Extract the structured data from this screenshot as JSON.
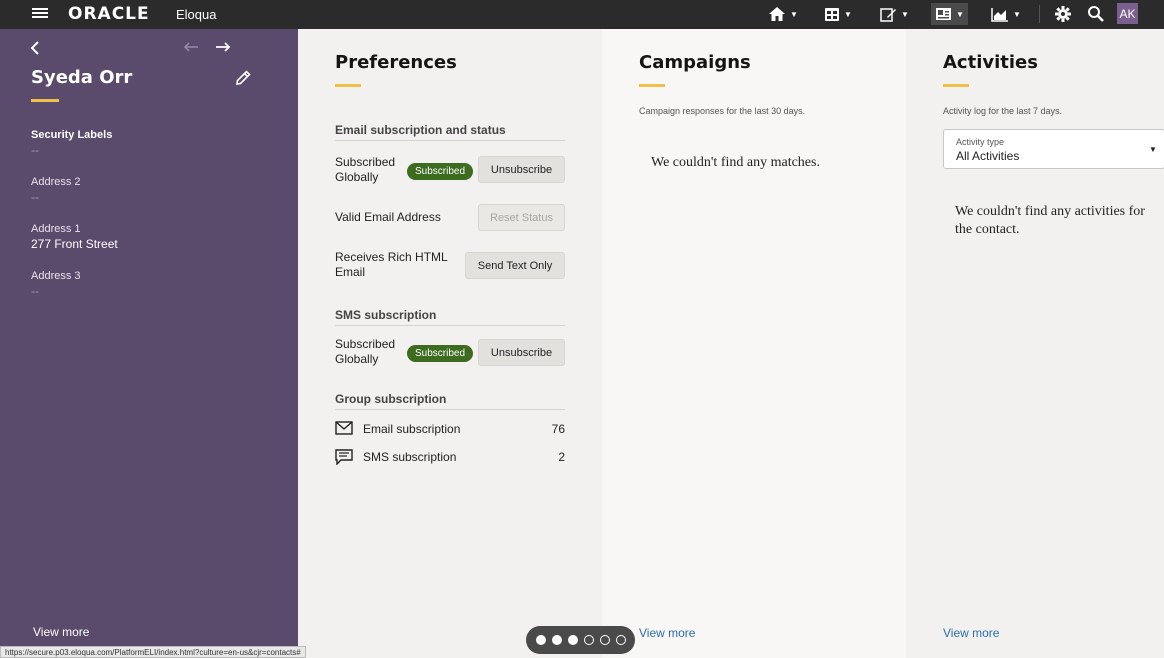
{
  "header": {
    "brand": "ORACLE",
    "product": "Eloqua",
    "icons": [
      {
        "name": "home-icon",
        "glyph": "⌂"
      },
      {
        "name": "contacts-icon",
        "glyph": "▣"
      },
      {
        "name": "edit-icon",
        "glyph": "✎"
      },
      {
        "name": "contact-card-icon",
        "glyph": "▤"
      },
      {
        "name": "chart-icon",
        "glyph": "▟"
      }
    ],
    "avatar": "AK"
  },
  "sidebar": {
    "name": "Syeda Orr",
    "fields": [
      {
        "label": "Security Labels",
        "value": "--"
      },
      {
        "label": "Address 2",
        "value": "--"
      },
      {
        "label": "Address 1",
        "value": "277 Front Street"
      },
      {
        "label": "Address 3",
        "value": "--"
      }
    ],
    "view_more": "View more"
  },
  "preferences": {
    "title": "Preferences",
    "email_section": "Email subscription and status",
    "rows": [
      {
        "label": "Subscribed Globally",
        "badge": "Subscribed",
        "button": "Unsubscribe"
      },
      {
        "label": "Valid Email Address",
        "button": "Reset Status"
      },
      {
        "label": "Receives Rich HTML Email",
        "button": "Send Text Only"
      }
    ],
    "sms_section": "SMS subscription",
    "sms_row": {
      "label": "Subscribed Globally",
      "badge": "Subscribed",
      "button": "Unsubscribe"
    },
    "group_section": "Group subscription",
    "groups": [
      {
        "label": "Email subscription",
        "count": "76"
      },
      {
        "label": "SMS subscription",
        "count": "2"
      }
    ]
  },
  "campaigns": {
    "title": "Campaigns",
    "caption": "Campaign responses for the last 30 days.",
    "empty": "We couldn't find any matches.",
    "view_more": "View more"
  },
  "activities": {
    "title": "Activities",
    "caption": "Activity log for the last 7 days.",
    "select_label": "Activity type",
    "select_value": "All Activities",
    "empty": "We couldn't find any activities for the contact.",
    "view_more": "View more"
  },
  "status_url": "https://secure.p03.eloqua.com/PlatformELI/index.html?culture=en-us&cjr=contacts#"
}
